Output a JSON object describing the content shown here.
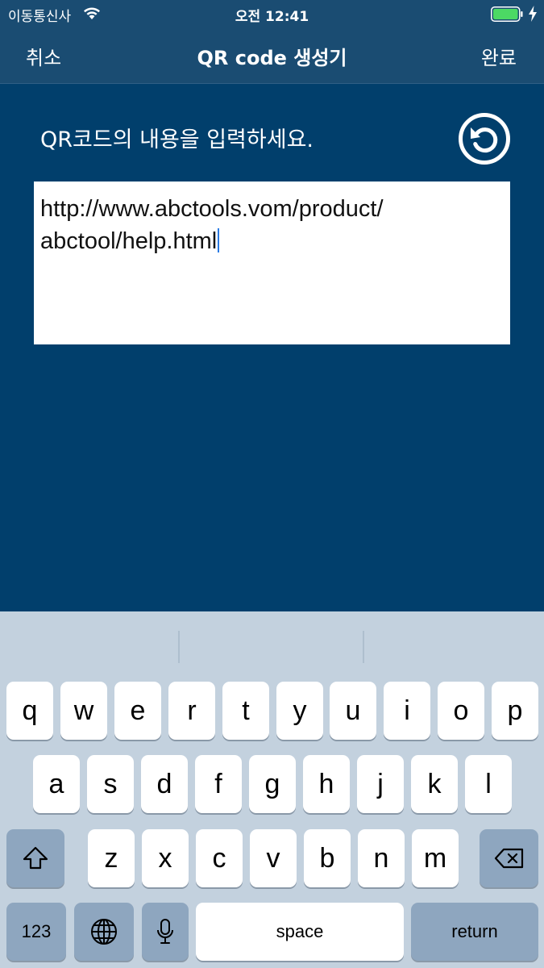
{
  "status_bar": {
    "carrier": "이동통신사",
    "time": "오전 12:41",
    "icons": [
      "wifi-icon",
      "battery-icon",
      "charging-bolt-icon"
    ],
    "battery_color": "#4cd964"
  },
  "nav": {
    "cancel_label": "취소",
    "title": "QR code 생성기",
    "done_label": "완료"
  },
  "form": {
    "prompt": "QR코드의 내용을 입력하세요.",
    "reset_icon": "reset-icon",
    "input_value": "http://www.abctools.vom/product/\nabctool/help.html"
  },
  "colors": {
    "background": "#013f6c",
    "bar": "#1a4c72",
    "keyboard": "#c3d1de",
    "function_key": "#8ea6bf"
  },
  "keyboard": {
    "row1": [
      "q",
      "w",
      "e",
      "r",
      "t",
      "y",
      "u",
      "i",
      "o",
      "p"
    ],
    "row2": [
      "a",
      "s",
      "d",
      "f",
      "g",
      "h",
      "j",
      "k",
      "l"
    ],
    "row3": [
      "z",
      "x",
      "c",
      "v",
      "b",
      "n",
      "m"
    ],
    "numbers_label": "123",
    "space_label": "space",
    "return_label": "return",
    "icons": [
      "shift-icon",
      "backspace-icon",
      "globe-icon",
      "microphone-icon"
    ]
  }
}
